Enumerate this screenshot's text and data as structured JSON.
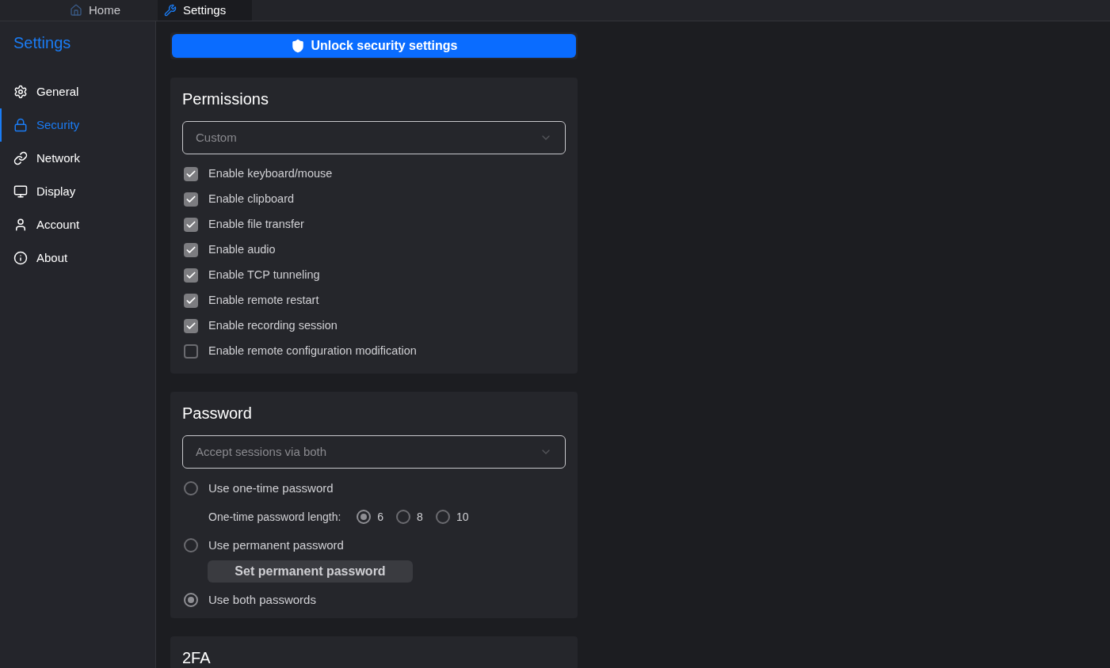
{
  "tabs": [
    {
      "label": "Home",
      "selected": false
    },
    {
      "label": "Settings",
      "selected": true
    }
  ],
  "sidebar": {
    "title": "Settings",
    "items": [
      {
        "label": "General",
        "selected": false
      },
      {
        "label": "Security",
        "selected": true
      },
      {
        "label": "Network",
        "selected": false
      },
      {
        "label": "Display",
        "selected": false
      },
      {
        "label": "Account",
        "selected": false
      },
      {
        "label": "About",
        "selected": false
      }
    ]
  },
  "unlock_button": "Unlock security settings",
  "permissions": {
    "title": "Permissions",
    "dropdown": "Custom",
    "checkboxes": [
      {
        "label": "Enable keyboard/mouse",
        "checked": true
      },
      {
        "label": "Enable clipboard",
        "checked": true
      },
      {
        "label": "Enable file transfer",
        "checked": true
      },
      {
        "label": "Enable audio",
        "checked": true
      },
      {
        "label": "Enable TCP tunneling",
        "checked": true
      },
      {
        "label": "Enable remote restart",
        "checked": true
      },
      {
        "label": "Enable recording session",
        "checked": true
      },
      {
        "label": "Enable remote configuration modification",
        "checked": false
      }
    ]
  },
  "password": {
    "title": "Password",
    "dropdown": "Accept sessions via both",
    "options": [
      {
        "label": "Use one-time password",
        "selected": false
      },
      {
        "label": "Use permanent password",
        "selected": false
      },
      {
        "label": "Use both passwords",
        "selected": true
      }
    ],
    "length": {
      "label": "One-time password length:",
      "choices": [
        {
          "label": "6",
          "selected": true
        },
        {
          "label": "8",
          "selected": false
        },
        {
          "label": "10",
          "selected": false
        }
      ]
    },
    "set_button": "Set permanent password"
  },
  "twofa": {
    "title": "2FA"
  }
}
